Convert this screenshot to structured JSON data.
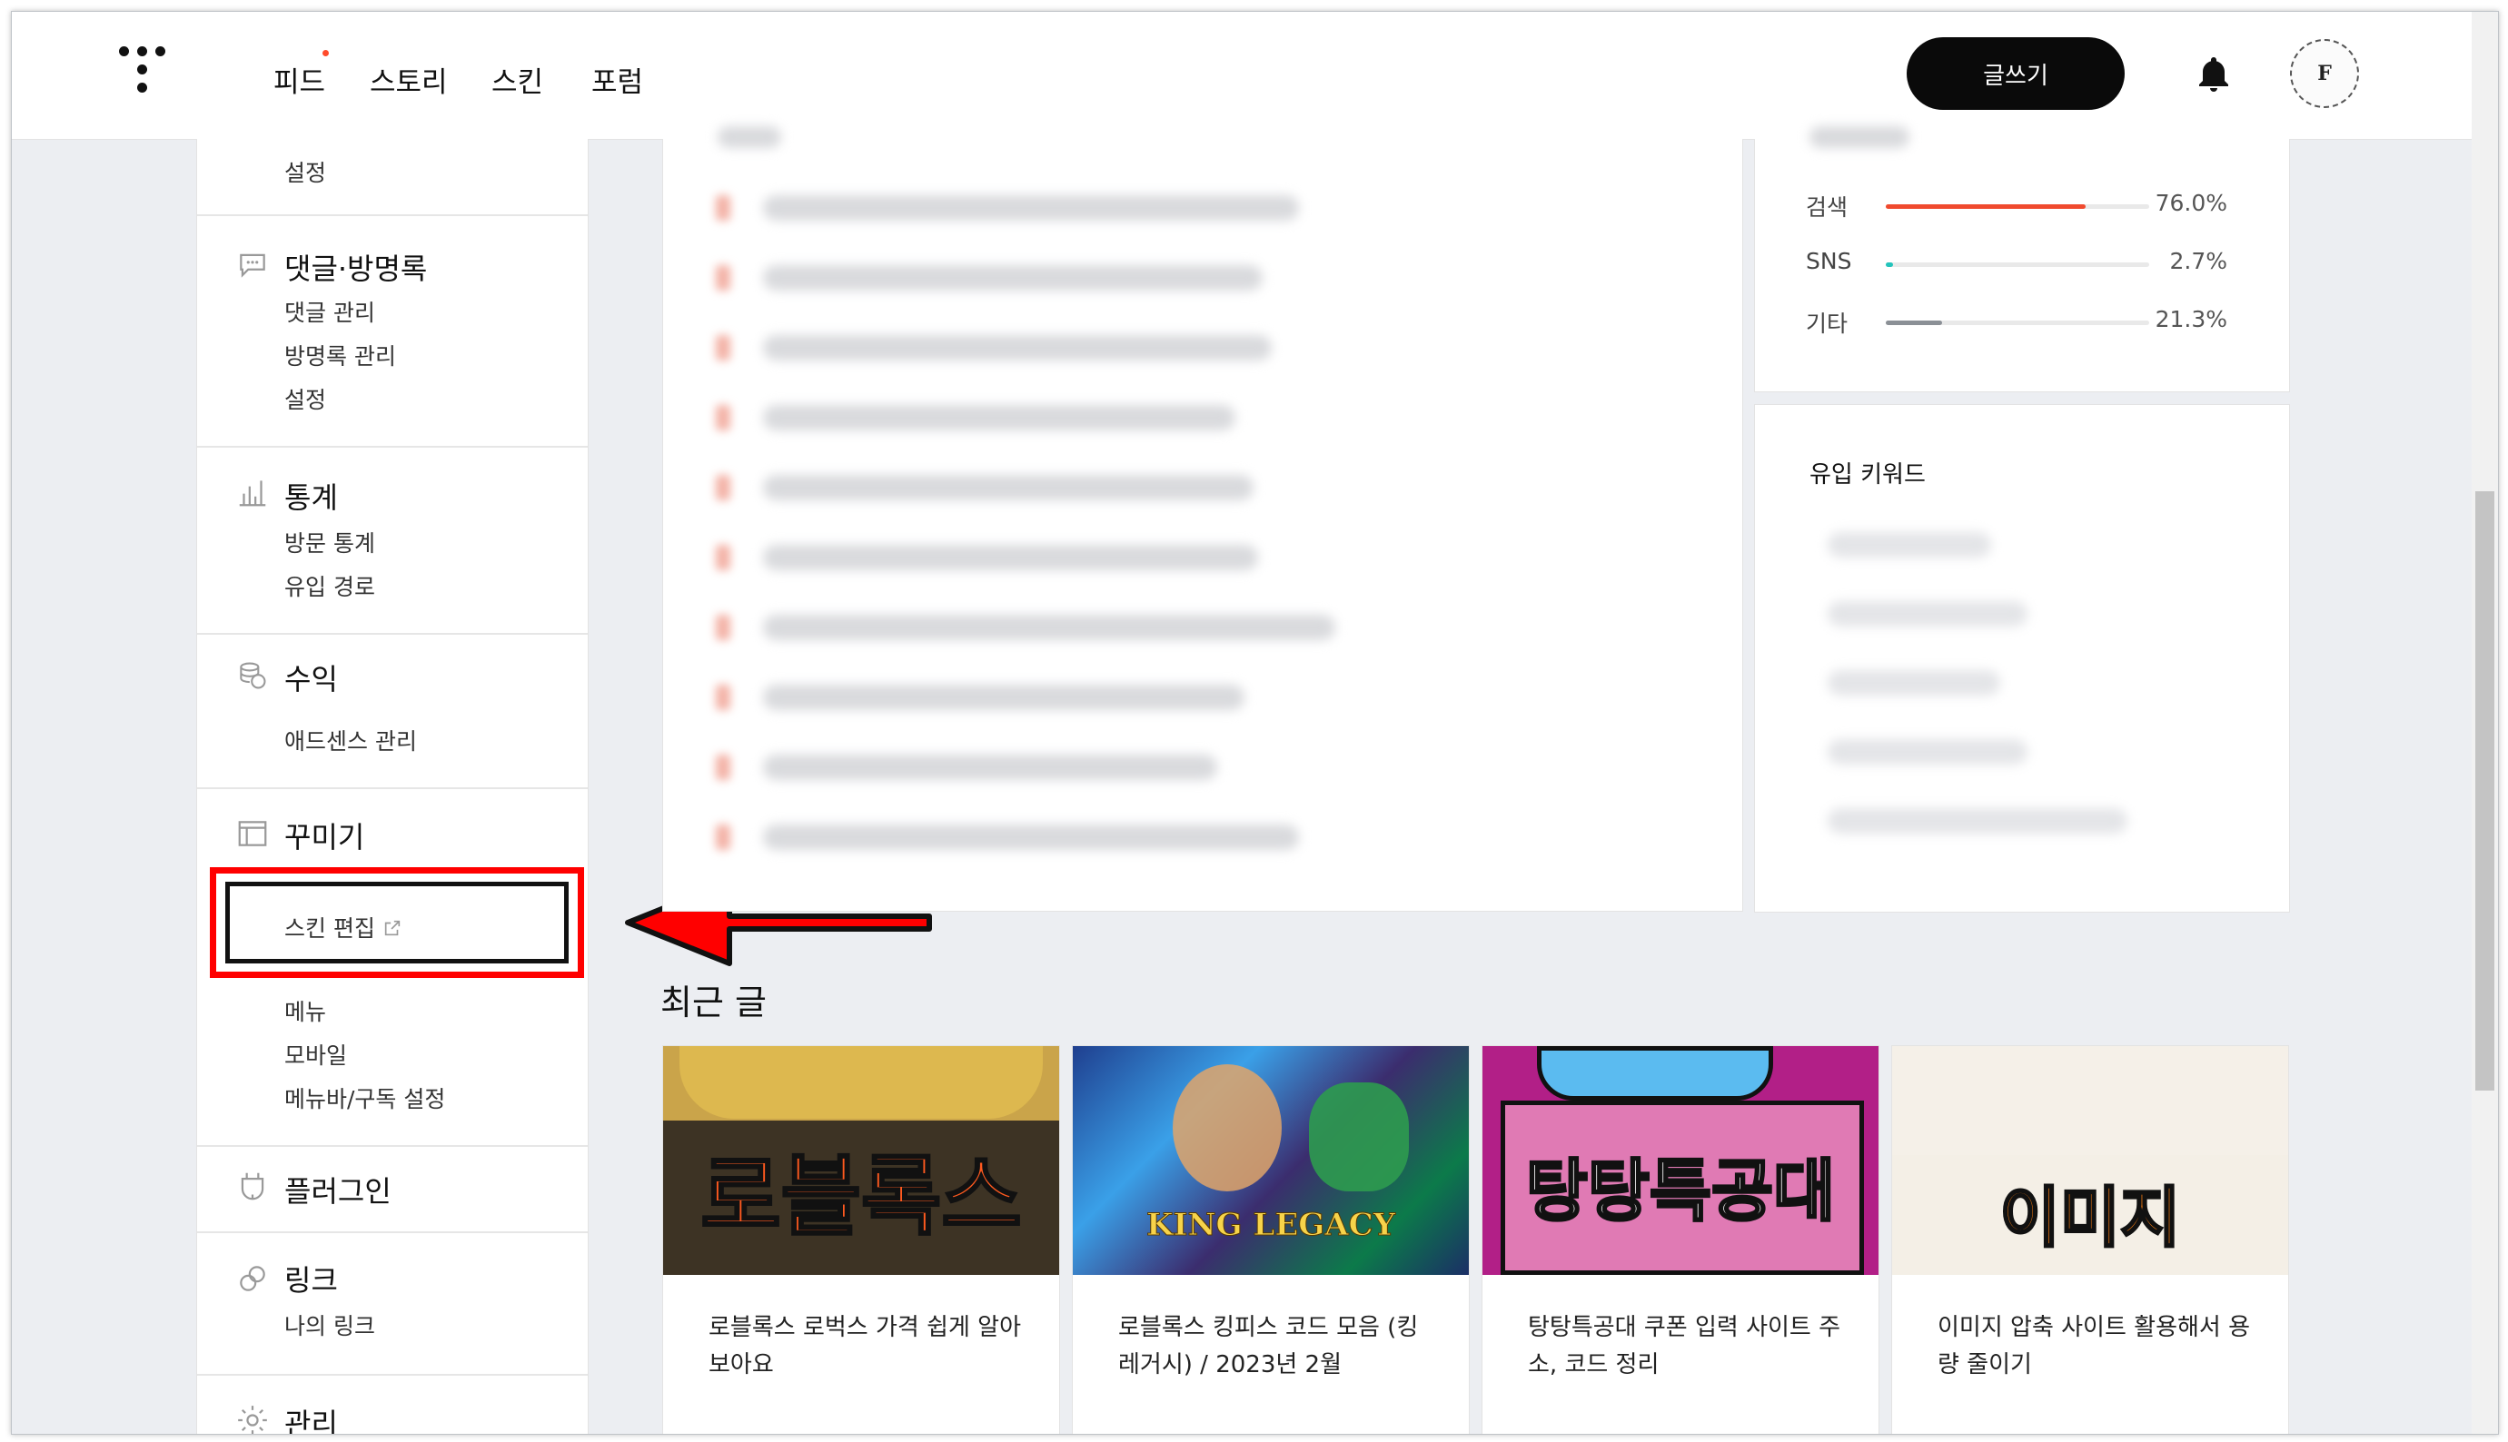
{
  "nav": {
    "items": [
      "피드",
      "스토리",
      "스킨",
      "포럼"
    ],
    "write_label": "글쓰기",
    "avatar_letter": "F"
  },
  "sidebar": {
    "top_sub": "설정",
    "comments": {
      "title": "댓글·방명록",
      "items": [
        "댓글 관리",
        "방명록 관리",
        "설정"
      ]
    },
    "stats": {
      "title": "통계",
      "items": [
        "방문 통계",
        "유입 경로"
      ]
    },
    "revenue": {
      "title": "수익",
      "items": [
        "애드센스 관리"
      ]
    },
    "design": {
      "title": "꾸미기",
      "items": [
        "스킨 편집",
        "메뉴",
        "모바일",
        "메뉴바/구독 설정"
      ]
    },
    "plugin": {
      "title": "플러그인"
    },
    "link": {
      "title": "링크",
      "items": [
        "나의 링크"
      ]
    },
    "manage": {
      "title": "관리"
    }
  },
  "inflow": {
    "rows": [
      {
        "label": "검색",
        "percent": "76.0%",
        "value": 0.76,
        "color": "#f04a2e"
      },
      {
        "label": "SNS",
        "percent": "2.7%",
        "value": 0.027,
        "color": "#24c4bc"
      },
      {
        "label": "기타",
        "percent": "21.3%",
        "value": 0.213,
        "color": "#8b9096"
      }
    ]
  },
  "keywords": {
    "title": "유입 키워드"
  },
  "recent": {
    "heading": "최근 글",
    "posts": [
      {
        "thumb_text": "로블록스",
        "title": "로블록스 로벅스 가격 쉽게 알아보아요"
      },
      {
        "thumb_text": "KING LEGACY",
        "title": "로블록스 킹피스 코드 모음 (킹 레거시) / 2023년 2월"
      },
      {
        "thumb_text": "탕탕특공대",
        "title": "탕탕특공대 쿠폰 입력 사이트 주소, 코드 정리"
      },
      {
        "thumb_text": "이미지",
        "title": "이미지 압축 사이트 활용해서 용량 줄이기"
      }
    ]
  },
  "colors": {
    "accent_red": "#ff0000",
    "nav_black": "#0a0a0a"
  }
}
